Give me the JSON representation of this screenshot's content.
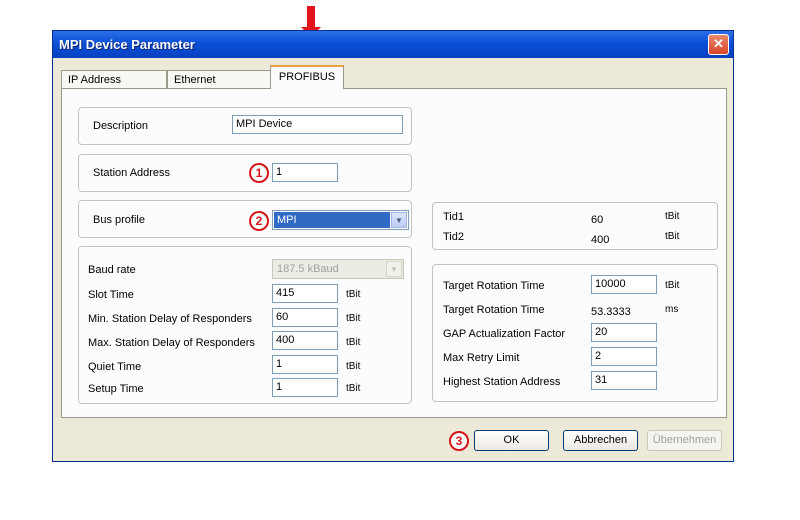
{
  "window": {
    "title": "MPI Device Parameter",
    "close_glyph": "✕"
  },
  "tabs": [
    {
      "label": "IP Address"
    },
    {
      "label": "Ethernet"
    },
    {
      "label": "PROFIBUS",
      "active": true
    }
  ],
  "description": {
    "label": "Description",
    "value": "MPI Device"
  },
  "station_address": {
    "label": "Station Address",
    "value": "1",
    "marker": "1"
  },
  "bus_profile": {
    "label": "Bus profile",
    "value": "MPI",
    "marker": "2"
  },
  "params": {
    "baud_rate": {
      "label": "Baud rate",
      "value": "187.5 kBaud"
    },
    "rows": [
      {
        "label": "Slot Time",
        "value": "415",
        "unit": "tBit"
      },
      {
        "label": "Min. Station Delay of Responders",
        "value": "60",
        "unit": "tBit"
      },
      {
        "label": "Max. Station Delay of Responders",
        "value": "400",
        "unit": "tBit"
      },
      {
        "label": "Quiet Time",
        "value": "1",
        "unit": "tBit"
      },
      {
        "label": "Setup Time",
        "value": "1",
        "unit": "tBit"
      }
    ]
  },
  "tid": {
    "rows": [
      {
        "label": "Tid1",
        "value": "60",
        "unit": "tBit"
      },
      {
        "label": "Tid2",
        "value": "400",
        "unit": "tBit"
      }
    ]
  },
  "rotation": {
    "target_rotation_time": {
      "label": "Target Rotation Time",
      "value": "10000",
      "unit": "tBit"
    },
    "target_rotation_time_ms": {
      "label": "Target Rotation Time",
      "value": "53.3333",
      "unit": "ms"
    },
    "gap_factor": {
      "label": "GAP Actualization Factor",
      "value": "20"
    },
    "max_retry": {
      "label": "Max Retry Limit",
      "value": "2"
    },
    "highest_station": {
      "label": "Highest Station Address",
      "value": "31"
    }
  },
  "buttons": {
    "ok": "OK",
    "cancel": "Abbrechen",
    "apply": "Übernehmen",
    "marker": "3"
  },
  "icons": {
    "dropdown": "chevron-down-icon",
    "close": "close-icon",
    "annotation": "red-arrow-down"
  },
  "colors": {
    "titlebar": "#0a4fd6",
    "marker": "#d6141b",
    "active_tab_accent": "#e8a33a"
  }
}
